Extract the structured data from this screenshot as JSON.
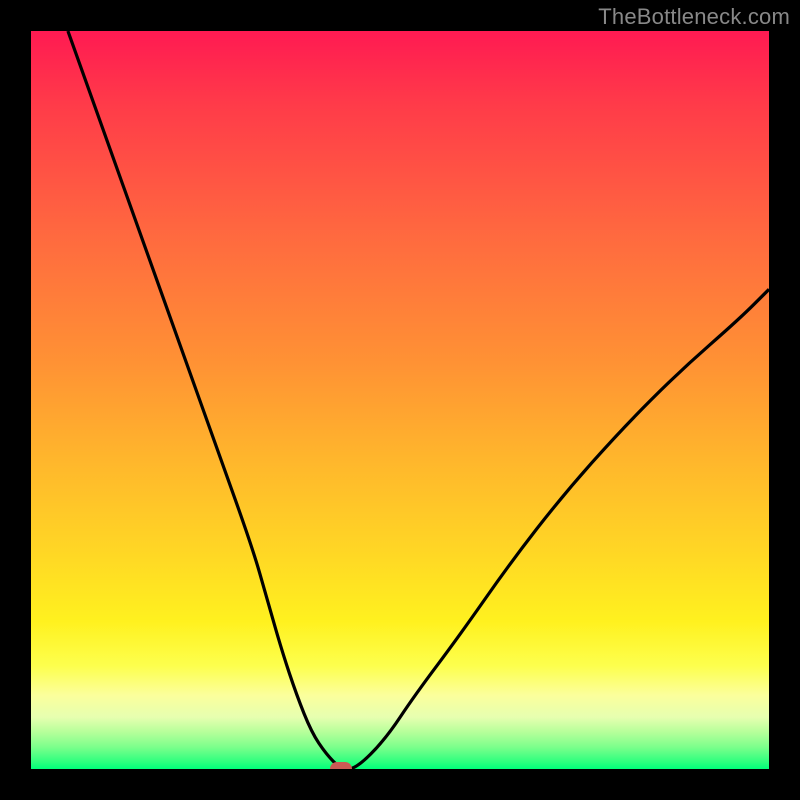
{
  "watermark": "TheBottleneck.com",
  "chart_data": {
    "type": "line",
    "title": "",
    "xlabel": "",
    "ylabel": "",
    "xlim": [
      0,
      100
    ],
    "ylim": [
      0,
      100
    ],
    "grid": false,
    "series": [
      {
        "name": "bottleneck-curve",
        "color": "#000000",
        "x": [
          5,
          10,
          15,
          20,
          25,
          30,
          32,
          34,
          36,
          38,
          40,
          42,
          44,
          48,
          52,
          58,
          65,
          72,
          80,
          88,
          96,
          100
        ],
        "values": [
          100,
          86,
          72,
          58,
          44,
          30,
          23,
          16,
          10,
          5,
          2,
          0,
          0,
          4,
          10,
          18,
          28,
          37,
          46,
          54,
          61,
          65
        ]
      }
    ],
    "marker": {
      "name": "bottleneck-point",
      "x": 42,
      "y": 0,
      "color": "#cc5a54"
    },
    "background_gradient": [
      "#ff1a52",
      "#ff6a3f",
      "#ffd525",
      "#fbff9c",
      "#00ff7a"
    ]
  }
}
